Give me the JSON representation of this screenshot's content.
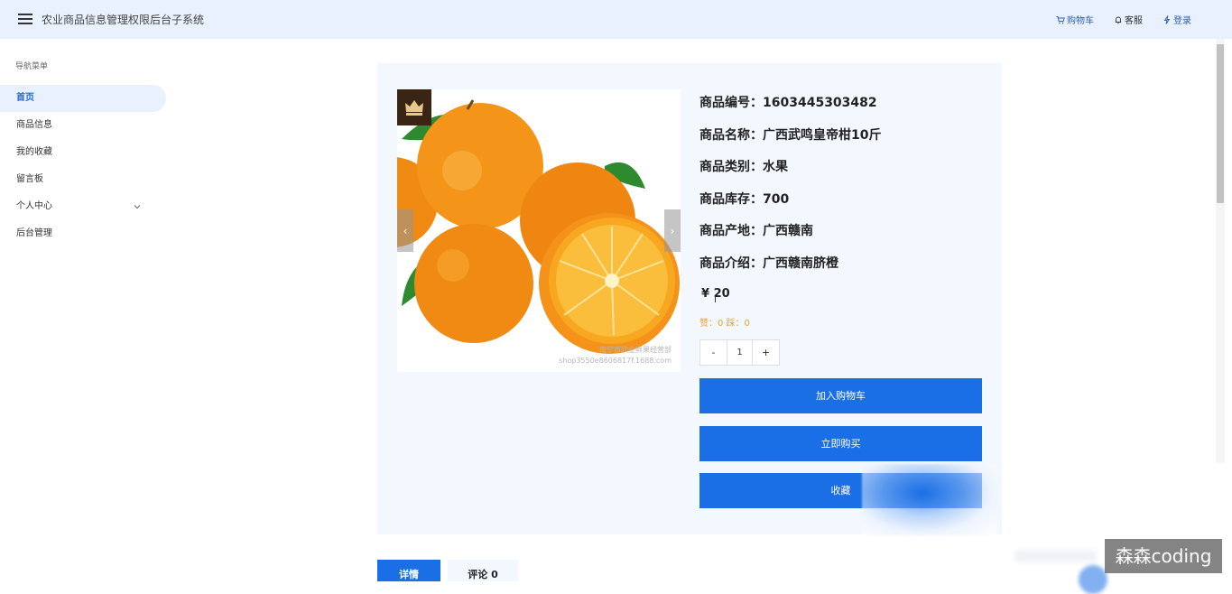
{
  "header": {
    "title": "农业商品信息管理权限后台子系统",
    "actions": [
      {
        "label": "购物车",
        "icon": "cart-icon"
      },
      {
        "label": "客服",
        "icon": "bell-icon"
      },
      {
        "label": "登录",
        "icon": "lightning-icon"
      }
    ]
  },
  "sidebar": {
    "title": "导航菜单",
    "items": [
      {
        "label": "首页",
        "active": true
      },
      {
        "label": "商品信息"
      },
      {
        "label": "我的收藏"
      },
      {
        "label": "留言板"
      },
      {
        "label": "个人中心",
        "expandable": true
      },
      {
        "label": "后台管理"
      }
    ]
  },
  "product": {
    "image_caption": "南宁市欣业鲜果经营部",
    "image_url_text": "shop3550e8606817f.1688.com",
    "fields": [
      "商品编号：1603445303482",
      "商品名称：广西武鸣皇帝柑10斤",
      "商品类别：水果",
      "商品库存：700",
      "商品产地：广西赣南",
      "商品介绍：广西赣南脐橙"
    ],
    "price": "¥ 20",
    "likes": "赞：0 踩：0",
    "quantity": "1",
    "minus_label": "-",
    "plus_label": "+",
    "buttons": {
      "add_cart": "加入购物车",
      "buy_now": "立即购买",
      "favorite": "收藏"
    }
  },
  "tabs": [
    {
      "label": "详情",
      "active": true
    },
    {
      "label": "评论 0"
    }
  ],
  "watermark": "森森coding",
  "colors": {
    "primary": "#1b6fe6",
    "header_bg": "#e8f1fd",
    "panel_bg": "#f3f8fe",
    "likes": "#e9a23b"
  }
}
